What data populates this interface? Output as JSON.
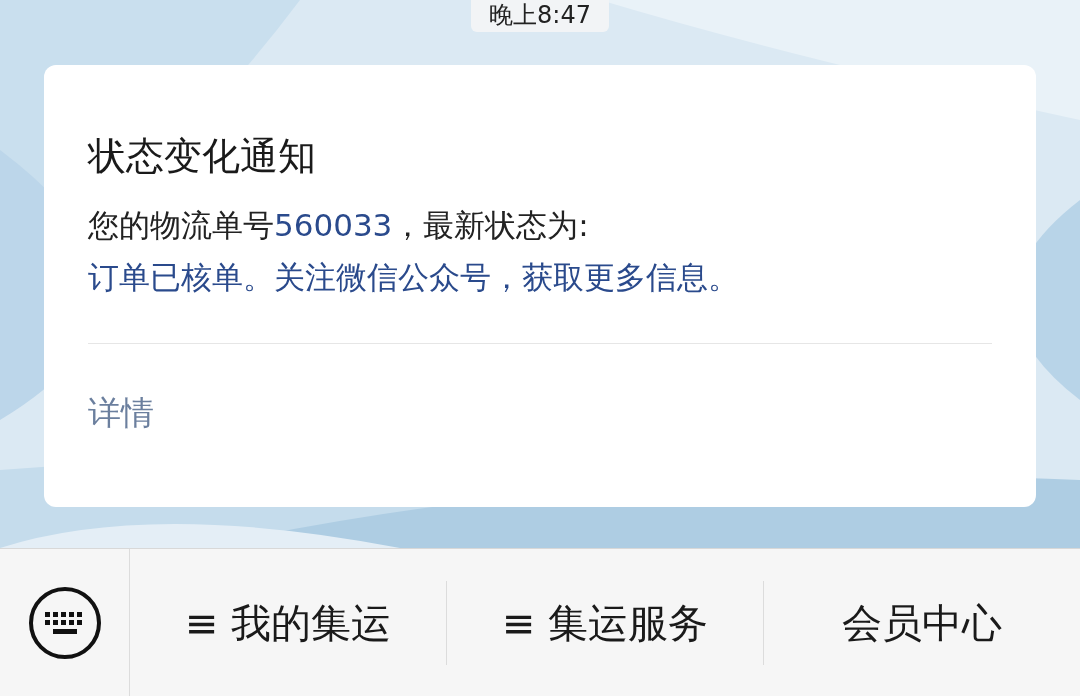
{
  "time": "晚上8:47",
  "card": {
    "title": "状态变化通知",
    "lines": [
      [
        {
          "text": "您的物流单号",
          "highlight": false
        },
        {
          "text": "560033",
          "highlight": true
        },
        {
          "text": "，最新状态为:",
          "highlight": false
        }
      ],
      [
        {
          "text": "订单已核单。关注微信公众号，获取更多信息。",
          "highlight": true
        }
      ]
    ],
    "link": "详情"
  },
  "menu": [
    "≡ 我的集运",
    "≡ 集运服务",
    "会员中心"
  ]
}
